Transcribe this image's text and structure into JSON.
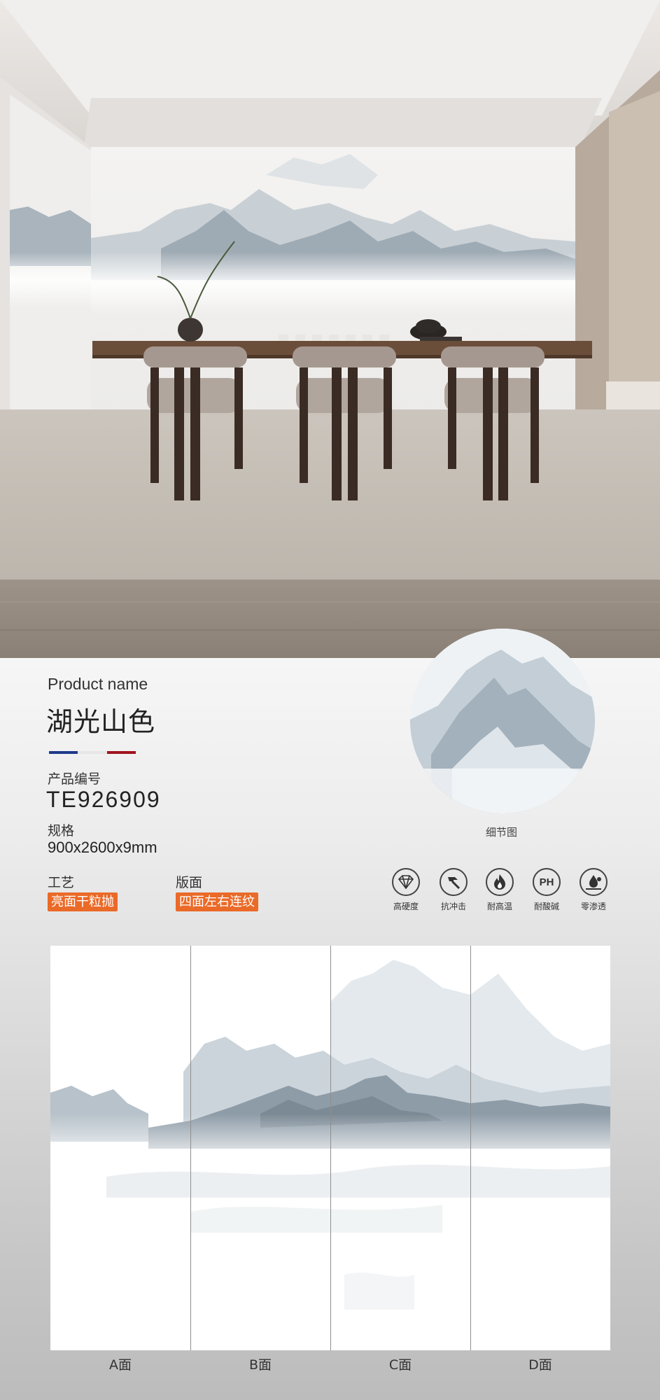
{
  "product": {
    "name_label": "Product name",
    "name": "湖光山色",
    "code_label": "产品编号",
    "code": "TE926909",
    "spec_label": "规格",
    "spec": "900x2600x9mm",
    "craft_label": "工艺",
    "craft": "亮面干粒抛",
    "face_label": "版面",
    "face": "四面左右连纹"
  },
  "detail": {
    "label": "细节图"
  },
  "features": [
    {
      "icon": "diamond-icon",
      "label": "高硬度"
    },
    {
      "icon": "hammer-icon",
      "label": "抗冲击"
    },
    {
      "icon": "flame-icon",
      "label": "耐高温"
    },
    {
      "icon": "ph-icon",
      "label": "耐酸碱",
      "glyph": "PH"
    },
    {
      "icon": "water-drop-icon",
      "label": "零渗透"
    }
  ],
  "panels": [
    {
      "label": "A面"
    },
    {
      "label": "B面"
    },
    {
      "label": "C面"
    },
    {
      "label": "D面"
    }
  ],
  "colors": {
    "accent_tag": "#ea6a28",
    "flag_blue": "#1f3a8a",
    "flag_white": "#e6e6e6",
    "flag_red": "#a0141e"
  }
}
